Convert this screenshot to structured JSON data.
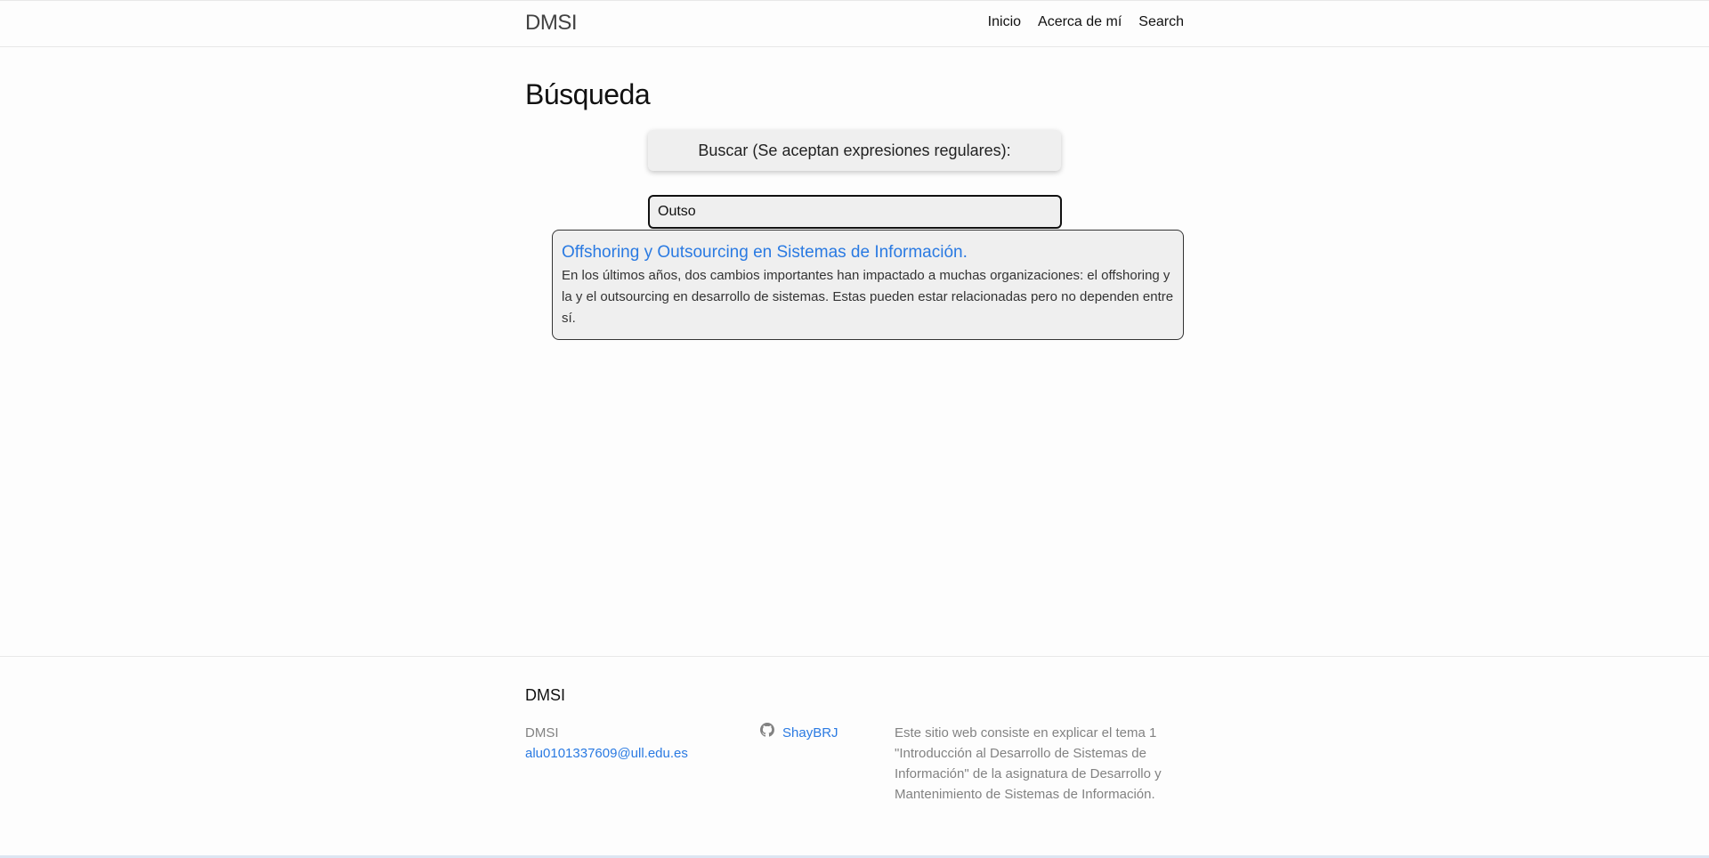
{
  "header": {
    "site_title": "DMSI",
    "nav": [
      "Inicio",
      "Acerca de mí",
      "Search"
    ]
  },
  "main": {
    "title": "Búsqueda",
    "search_label": "Buscar (Se aceptan expresiones regulares):",
    "search_value": "Outso",
    "results": [
      {
        "title": "Offshoring y Outsourcing en Sistemas de Información.",
        "excerpt": "En los últimos años, dos cambios importantes han impactado a muchas organizaciones: el offshoring y la y el outsourcing en desarrollo de sistemas. Estas pueden estar relacionadas pero no dependen entre sí."
      }
    ]
  },
  "footer": {
    "heading": "DMSI",
    "name": "DMSI",
    "email": "alu0101337609@ull.edu.es",
    "github_user": "ShayBRJ",
    "description": "Este sitio web consiste en explicar el tema 1 \"Introducción al Desarrollo de Sistemas de Información\" de la asignatura de Desarrollo y Mantenimiento de Sistemas de Información."
  },
  "colors": {
    "link": "#2a7ae2",
    "muted_text": "#828282",
    "panel_background": "#efefef"
  },
  "icons": {
    "github": "github-icon"
  }
}
